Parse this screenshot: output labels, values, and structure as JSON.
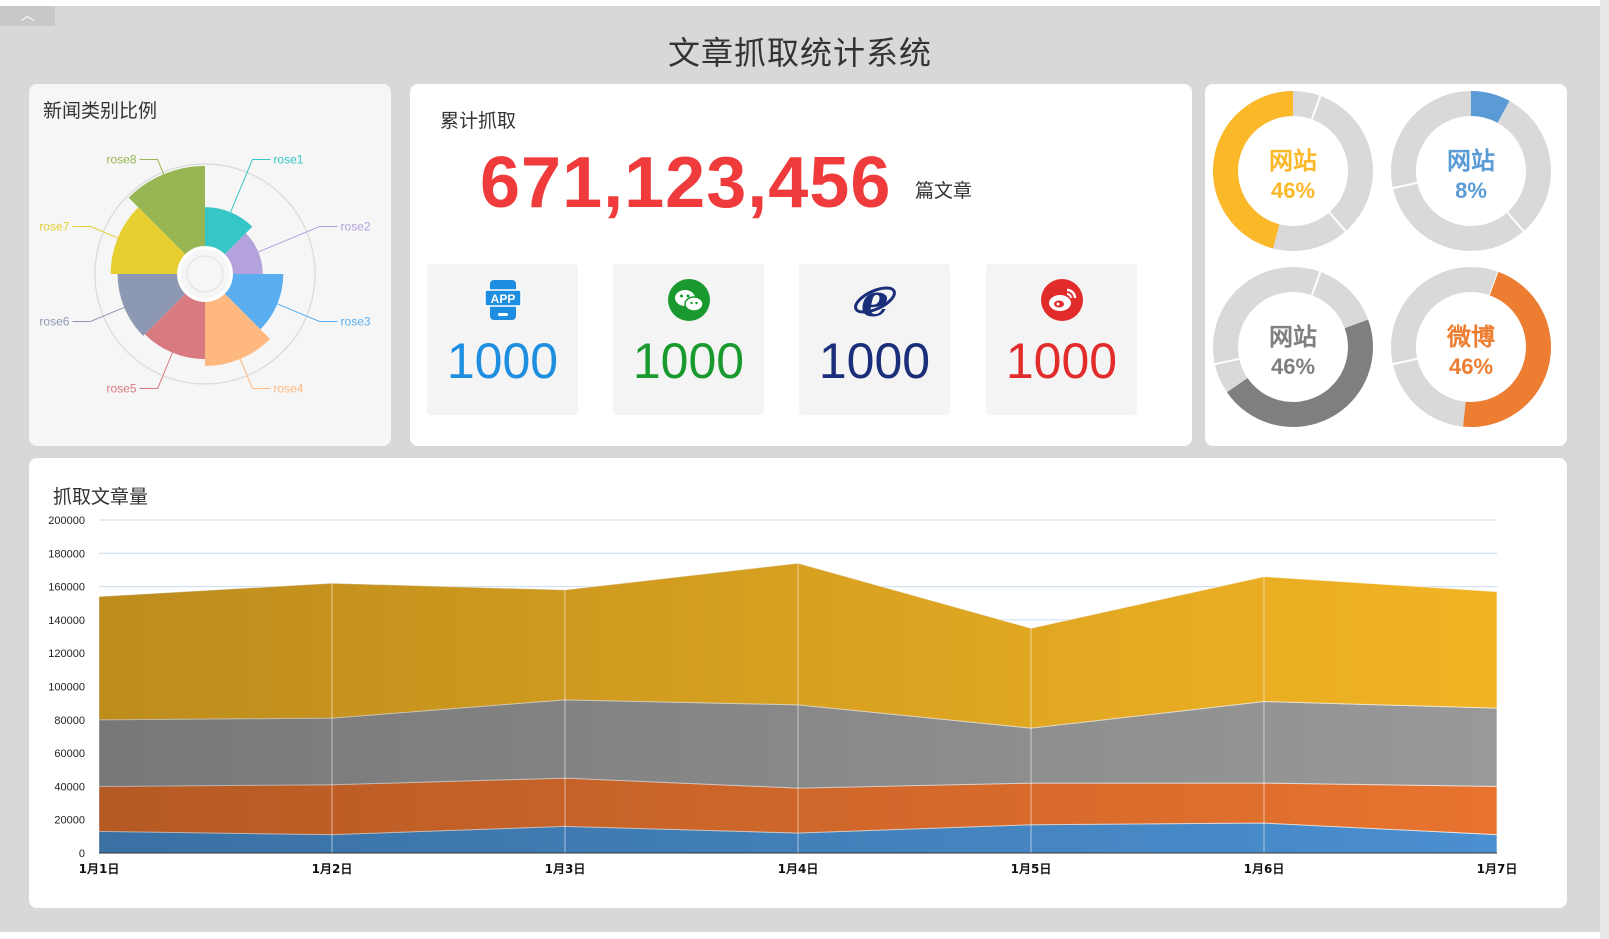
{
  "window": {
    "collapse_glyph": "︿"
  },
  "header": {
    "title": "文章抓取统计系统"
  },
  "rose_panel": {
    "title": "新闻类别比例"
  },
  "total_panel": {
    "title": "累计抓取",
    "total": "671,123,456",
    "unit": "篇文章",
    "stats": [
      {
        "icon": "app-icon",
        "value": "1000",
        "color": "#1e8ee0"
      },
      {
        "icon": "wechat-icon",
        "value": "1000",
        "color": "#1a9a2e"
      },
      {
        "icon": "ie-browser-icon",
        "value": "1000",
        "color": "#1b2e7a"
      },
      {
        "icon": "weibo-icon",
        "value": "1000",
        "color": "#e22c2c"
      }
    ]
  },
  "donuts": [
    {
      "label": "网站",
      "percent_text": "46%",
      "value": 46,
      "color": "#fbb829"
    },
    {
      "label": "网站",
      "percent_text": "8%",
      "value": 8,
      "color": "#5b9bd5"
    },
    {
      "label": "网站",
      "percent_text": "46%",
      "value": 46,
      "color": "#7f7f7f"
    },
    {
      "label": "微博",
      "percent_text": "46%",
      "value": 46,
      "color": "#ed7d31"
    }
  ],
  "area_panel": {
    "title": "抓取文章量"
  },
  "chart_data": [
    {
      "type": "pie",
      "variant": "nightingale-rose",
      "title": "新闻类别比例",
      "categories": [
        "rose1",
        "rose2",
        "rose3",
        "rose4",
        "rose5",
        "rose6",
        "rose7",
        "rose8"
      ],
      "values": [
        17,
        13,
        22,
        28,
        25,
        26,
        29,
        35
      ],
      "colors": [
        "#37c6c6",
        "#b4a2dc",
        "#5aaef0",
        "#ffb980",
        "#d87a80",
        "#8d98b3",
        "#e5cf31",
        "#97b552"
      ]
    },
    {
      "type": "area",
      "stacked": true,
      "title": "抓取文章量",
      "categories": [
        "1月1日",
        "1月2日",
        "1月3日",
        "1月4日",
        "1月5日",
        "1月6日",
        "1月7日"
      ],
      "series": [
        {
          "values": [
            13000,
            11000,
            16000,
            12000,
            17000,
            18000,
            11000
          ],
          "color": "#4a8fd0"
        },
        {
          "values": [
            27000,
            30000,
            29000,
            27000,
            25000,
            24000,
            29000
          ],
          "color": "#e8732f"
        },
        {
          "values": [
            40000,
            40000,
            47000,
            50000,
            33000,
            49000,
            47000
          ],
          "color": "#999999"
        },
        {
          "values": [
            74000,
            81000,
            66000,
            85000,
            60000,
            75000,
            70000
          ],
          "color": "#f2b424"
        }
      ],
      "ylim": [
        0,
        200000
      ],
      "yticks": [
        0,
        20000,
        40000,
        60000,
        80000,
        100000,
        120000,
        140000,
        160000,
        180000,
        200000
      ],
      "grid": true
    }
  ]
}
